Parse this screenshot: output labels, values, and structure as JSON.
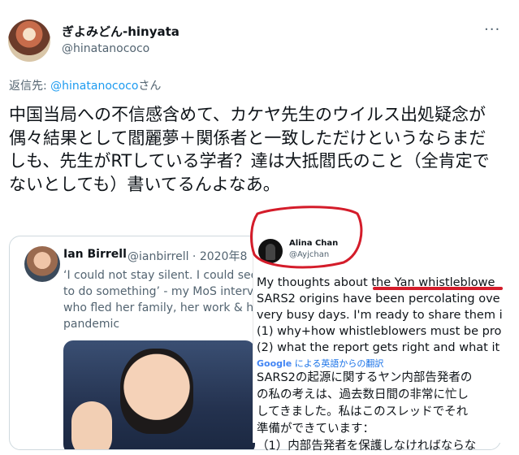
{
  "tweet": {
    "display_name": "ぎよみどん-hinyata",
    "handle": "@hinatanococo",
    "more_icon": "more-horizontal-icon",
    "more_glyph": "···",
    "reply_prefix": "返信先: ",
    "reply_mention": "@hinatanococo",
    "reply_suffix": "さん",
    "body": "中国当局への不信感含めて、カケヤ先生のウイルス出処疑念が偶々結果として閻麗夢＋関係者と一致しただけというならまだしも、先生がRTしている学者？達は大抵閻氏のこと（全肯定でないとしても）書いてるんよなあ。"
  },
  "quote": {
    "name": "Ian Birrell",
    "handle_date": "@ianbirrell · 2020年8",
    "text": "‘I could not stay silent. I could see\nto do something’ - my MoS interv\nwho fled her family, her work & h\npandemic"
  },
  "overlay": {
    "name": "Alina Chan",
    "handle": "@Ayjchan",
    "text": "My thoughts about the Yan whistleblowe\nSARS2 origins have been percolating ove\nvery busy days. I'm ready to share them i\n(1) why+how whistleblowers must be pro\n(2) what the report gets right and what it",
    "translate_brand": "Google",
    "translate_label": " による英語からの翻訳",
    "ja_text": "SARS2の起源に関するヤン内部告発者の\nの私の考えは、過去数日間の非常に忙し\nしてきました。私はこのスレッドでそれ\n準備ができています：\n（1）内部告発者を保護しなければならな"
  },
  "colors": {
    "accent": "#1d9bf0",
    "annotation": "#d41c2a",
    "secondary_text": "#536471"
  }
}
